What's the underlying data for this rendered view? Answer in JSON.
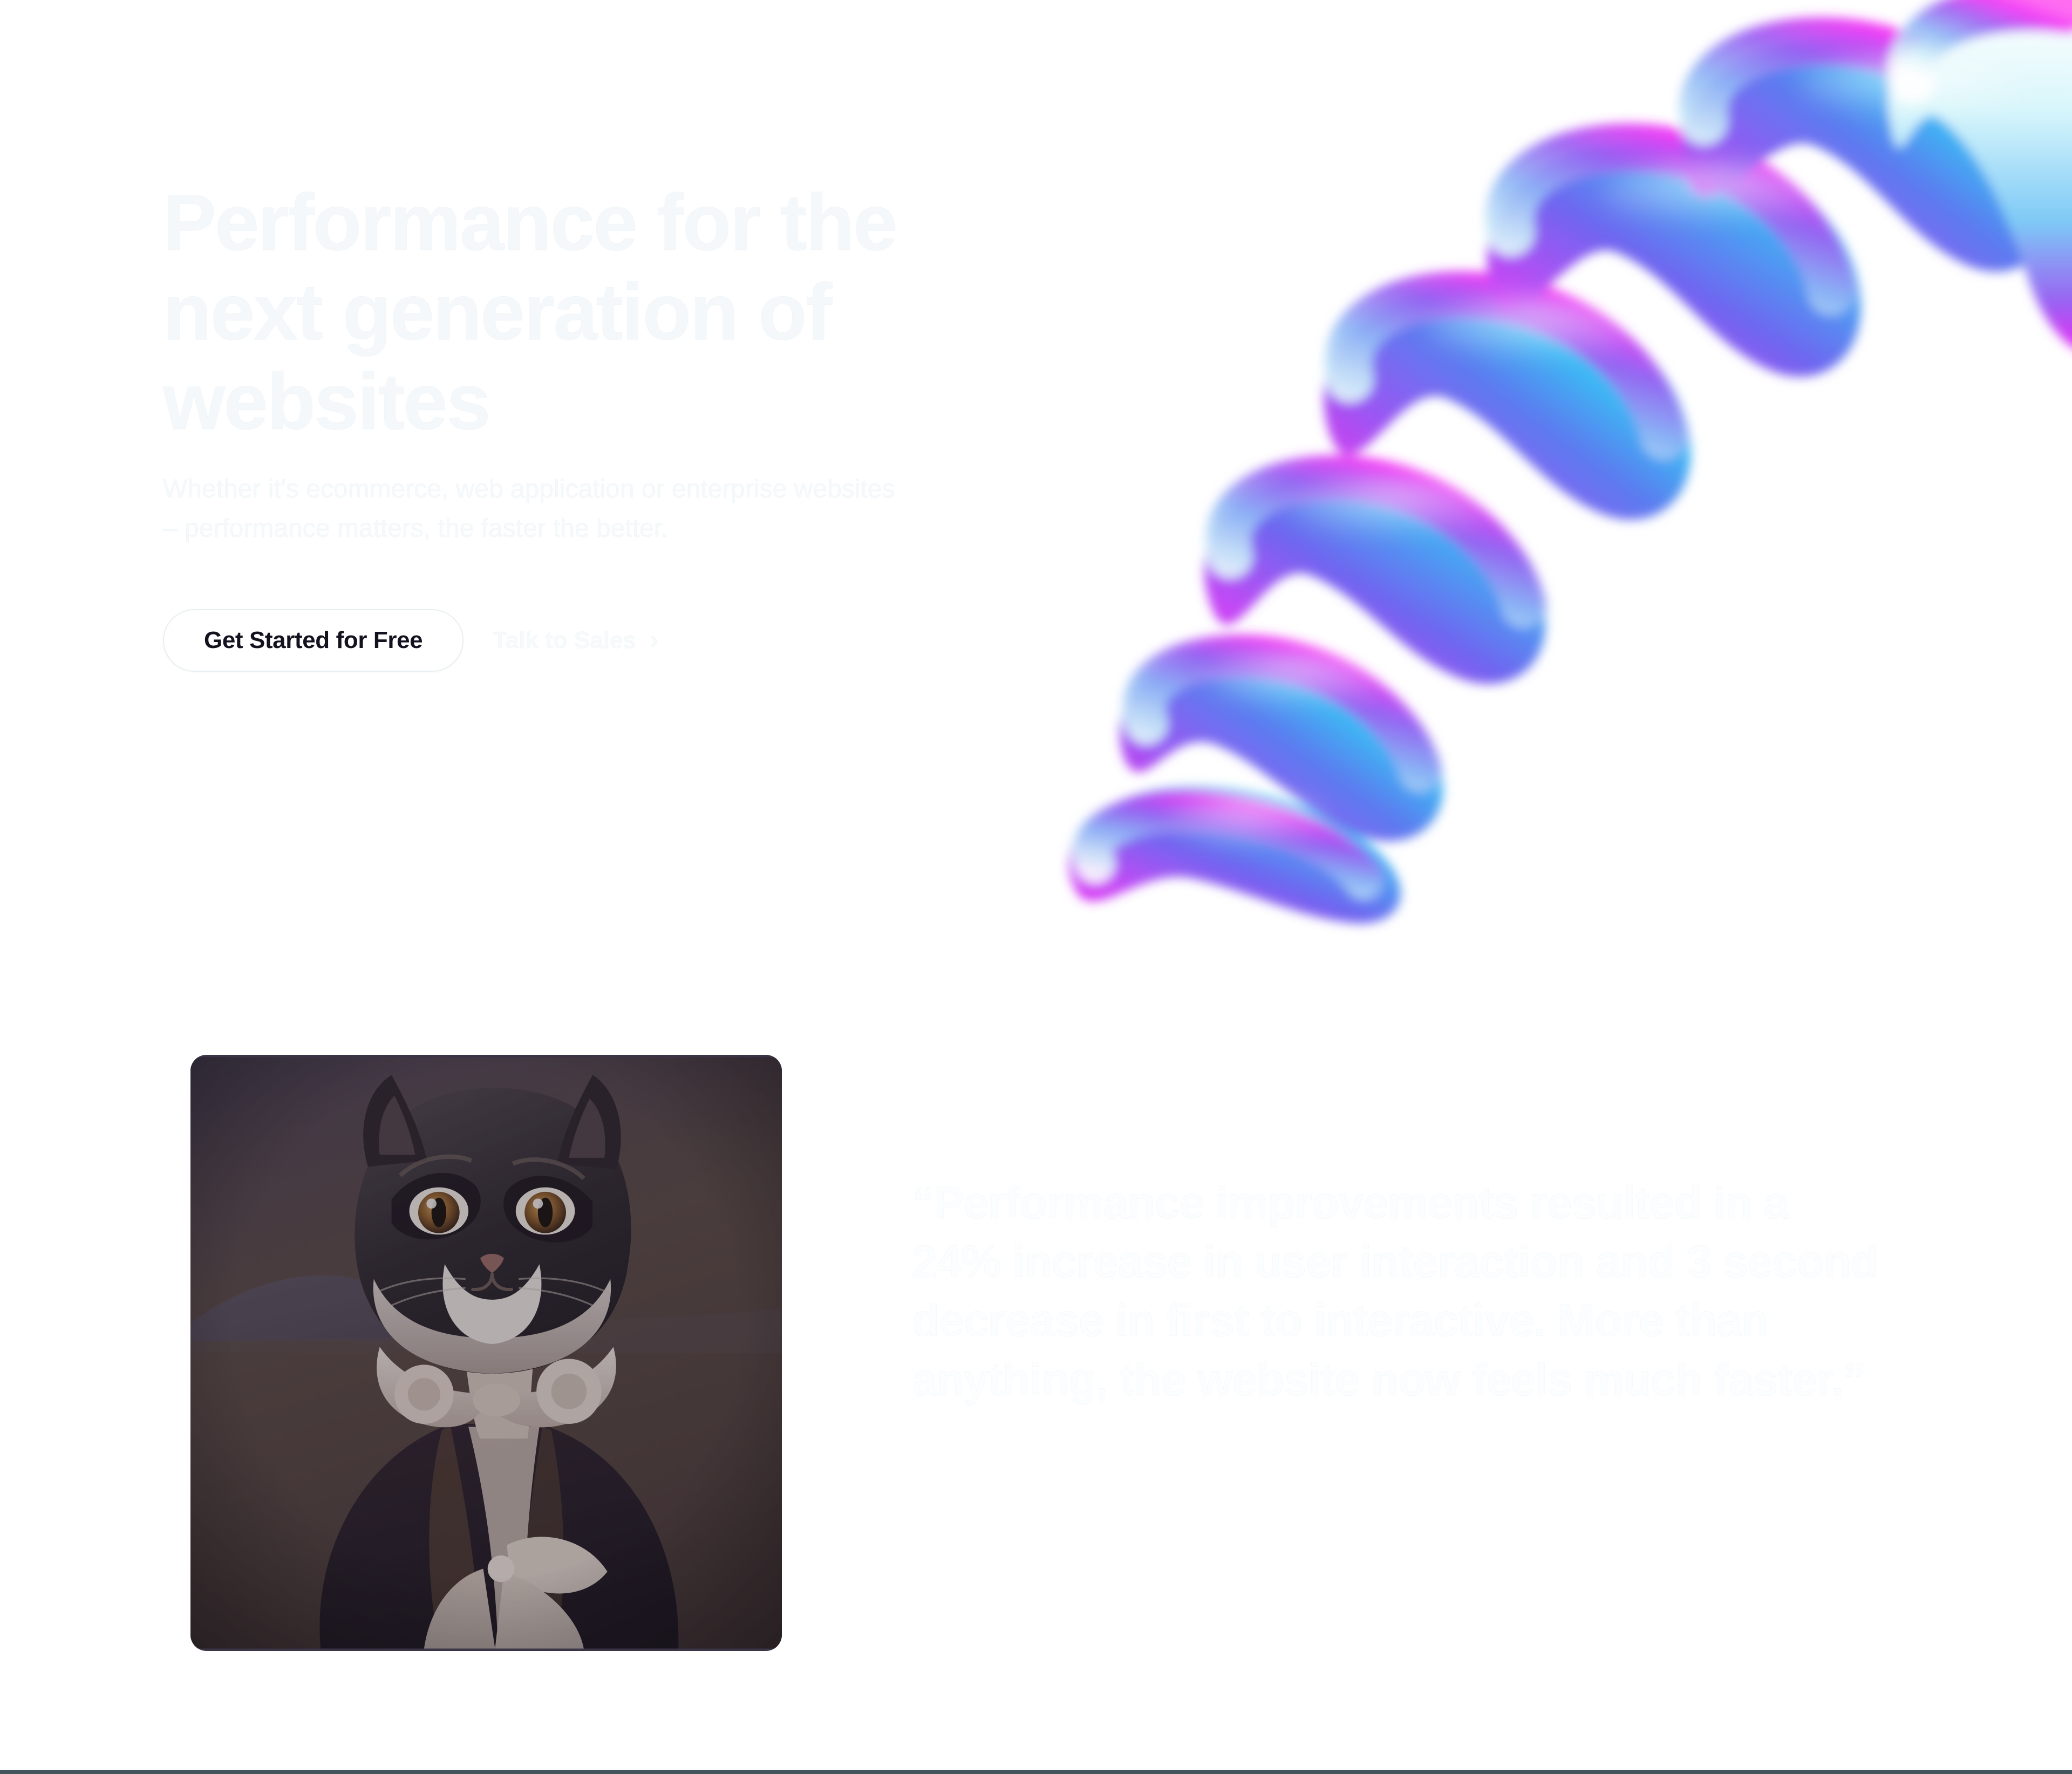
{
  "hero": {
    "headline": "Performance for the next generation of websites",
    "subhead": "Whether it's ecommerce, web application or enterprise websites – performance matters, the faster the better.",
    "primary_cta": "Get Started for Free",
    "secondary_cta": "Talk to Sales",
    "secondary_cta_icon": "chevron-right-icon",
    "chevron_glyph": "›",
    "art": {
      "name": "gradient-spiral-coil",
      "colors": {
        "magenta": "#f221f7",
        "pink": "#ff4de0",
        "violet": "#7a5cf0",
        "indigo": "#5b63ec",
        "blue": "#3aa8f5",
        "cyan": "#22e8f5",
        "highlight": "#ffffff"
      }
    }
  },
  "testimonial": {
    "portrait_alt": "victorian-cat-portrait",
    "quote": "“Performance improvements resulted in a 24% increase in user interaction and 3 second decrease in first to interactive. More than anything, the website now feels much faster.”",
    "metrics": {
      "interaction_increase": "24%",
      "time_to_interactive_decrease": "3 second"
    }
  },
  "theme": {
    "background": "#ffffff",
    "text_ghost": "#f4f8fa",
    "text_dark": "#15121f",
    "border_subtle": "#e9eef1",
    "footer_rule": "#43545c"
  }
}
